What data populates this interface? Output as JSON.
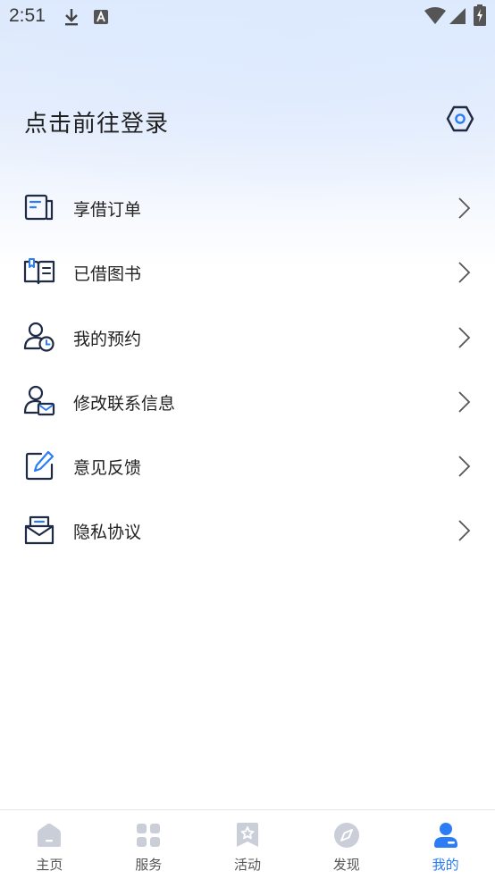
{
  "status_bar": {
    "time": "2:51",
    "icons": [
      "download-icon",
      "a-box-icon",
      "wifi-icon",
      "signal-icon",
      "battery-charging-icon"
    ]
  },
  "header": {
    "login_prompt": "点击前往登录",
    "settings_icon": "settings-hexagon-icon"
  },
  "menu": {
    "items": [
      {
        "label": "享借订单",
        "icon": "order-list-icon"
      },
      {
        "label": "已借图书",
        "icon": "open-book-icon"
      },
      {
        "label": "我的预约",
        "icon": "user-clock-icon"
      },
      {
        "label": "修改联系信息",
        "icon": "user-mail-icon"
      },
      {
        "label": "意见反馈",
        "icon": "edit-feedback-icon"
      },
      {
        "label": "隐私协议",
        "icon": "privacy-envelope-icon"
      }
    ]
  },
  "bottom_nav": {
    "items": [
      {
        "label": "主页",
        "icon": "home-icon",
        "active": false
      },
      {
        "label": "服务",
        "icon": "grid-icon",
        "active": false
      },
      {
        "label": "活动",
        "icon": "star-bookmark-icon",
        "active": false
      },
      {
        "label": "发现",
        "icon": "compass-icon",
        "active": false
      },
      {
        "label": "我的",
        "icon": "user-profile-icon",
        "active": true
      }
    ]
  },
  "colors": {
    "accent": "#2c7cf6",
    "icon_dark": "#1f2a44",
    "nav_inactive": "#c9ced8",
    "text": "#222222"
  }
}
